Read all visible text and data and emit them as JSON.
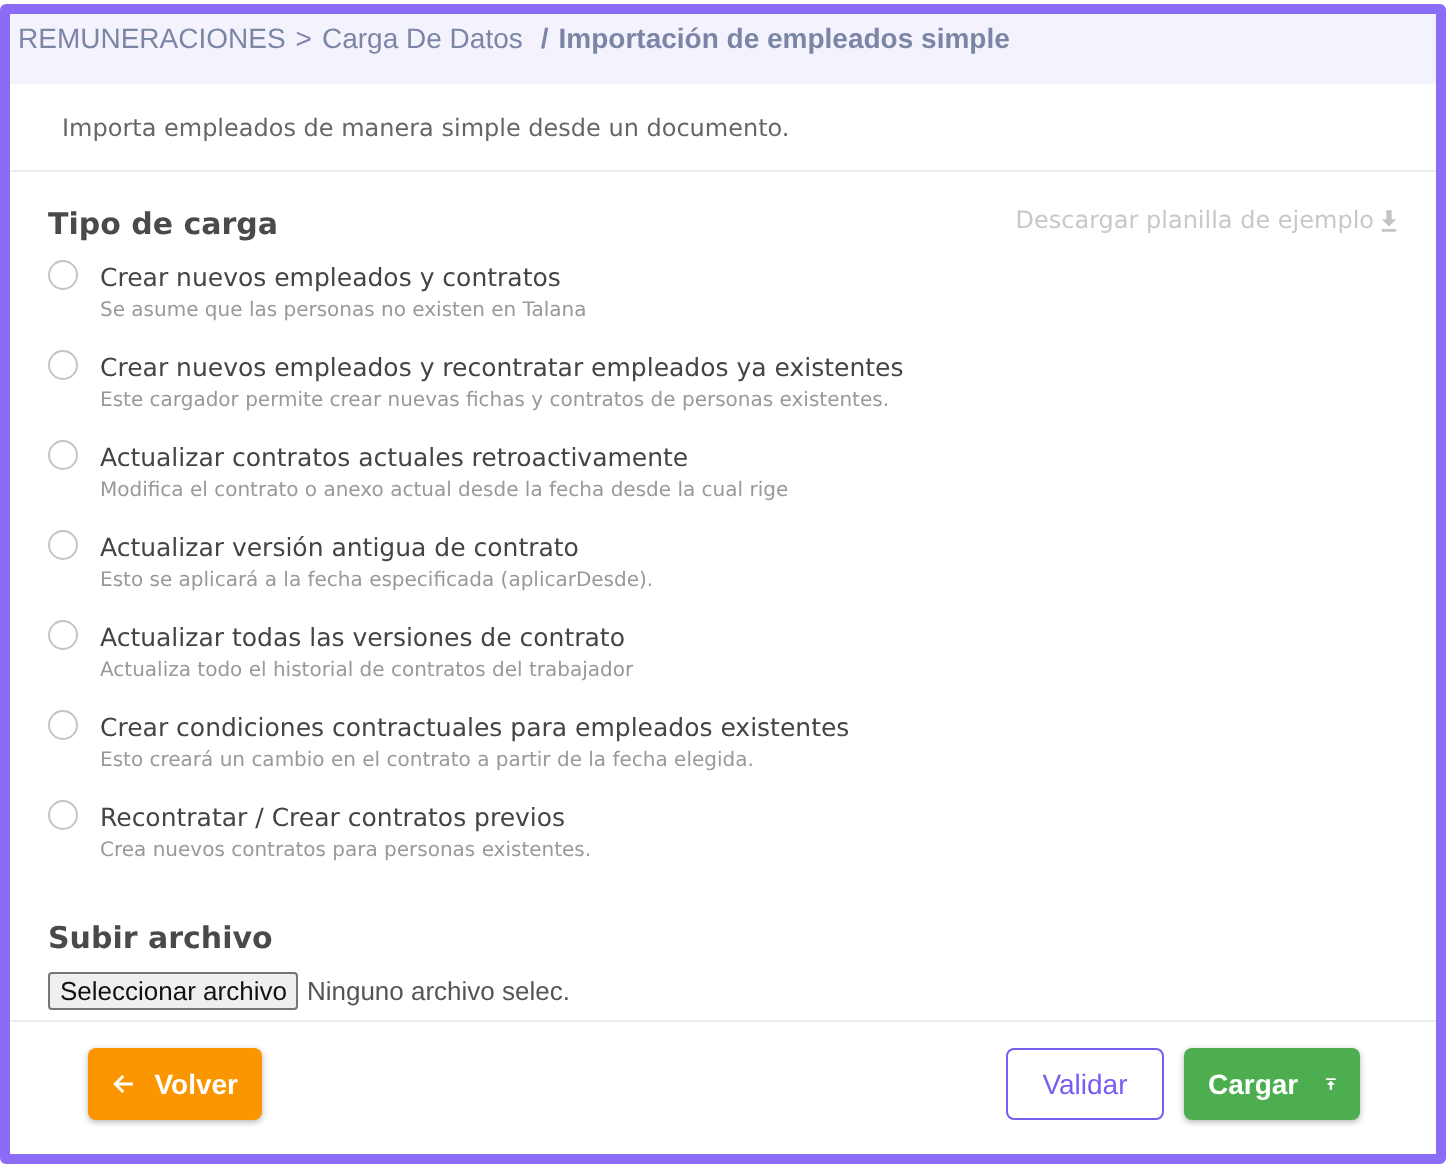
{
  "breadcrumb": {
    "items": [
      "REMUNERACIONES",
      "Carga De Datos"
    ],
    "separators": [
      ">",
      "/"
    ],
    "current": "Importación de empleados simple"
  },
  "description": "Importa empleados de manera simple desde un documento.",
  "load_type": {
    "title": "Tipo de carga",
    "download_link": "Descargar planilla de ejemplo",
    "options": [
      {
        "label": "Crear nuevos empleados y contratos",
        "hint": "Se asume que las personas no existen en Talana",
        "selected": false
      },
      {
        "label": "Crear nuevos empleados y recontratar empleados ya existentes",
        "hint": "Este cargador permite crear nuevas fichas y contratos de personas existentes.",
        "selected": false
      },
      {
        "label": "Actualizar contratos actuales retroactivamente",
        "hint": "Modifica el contrato o anexo actual desde la fecha desde la cual rige",
        "selected": false
      },
      {
        "label": "Actualizar versión antigua de contrato",
        "hint": "Esto se aplicará a la fecha especificada (aplicarDesde).",
        "selected": false
      },
      {
        "label": "Actualizar todas las versiones de contrato",
        "hint": "Actualiza todo el historial de contratos del trabajador",
        "selected": false
      },
      {
        "label": "Crear condiciones contractuales para empleados existentes",
        "hint": "Esto creará un cambio en el contrato a partir de la fecha elegida.",
        "selected": false
      },
      {
        "label": "Recontratar / Crear contratos previos",
        "hint": "Crea nuevos contratos para personas existentes.",
        "selected": false
      }
    ]
  },
  "upload": {
    "title": "Subir archivo",
    "button": "Seleccionar archivo",
    "file_status": "Ninguno archivo selec."
  },
  "footer": {
    "back": "Volver",
    "validate": "Validar",
    "submit": "Cargar"
  }
}
